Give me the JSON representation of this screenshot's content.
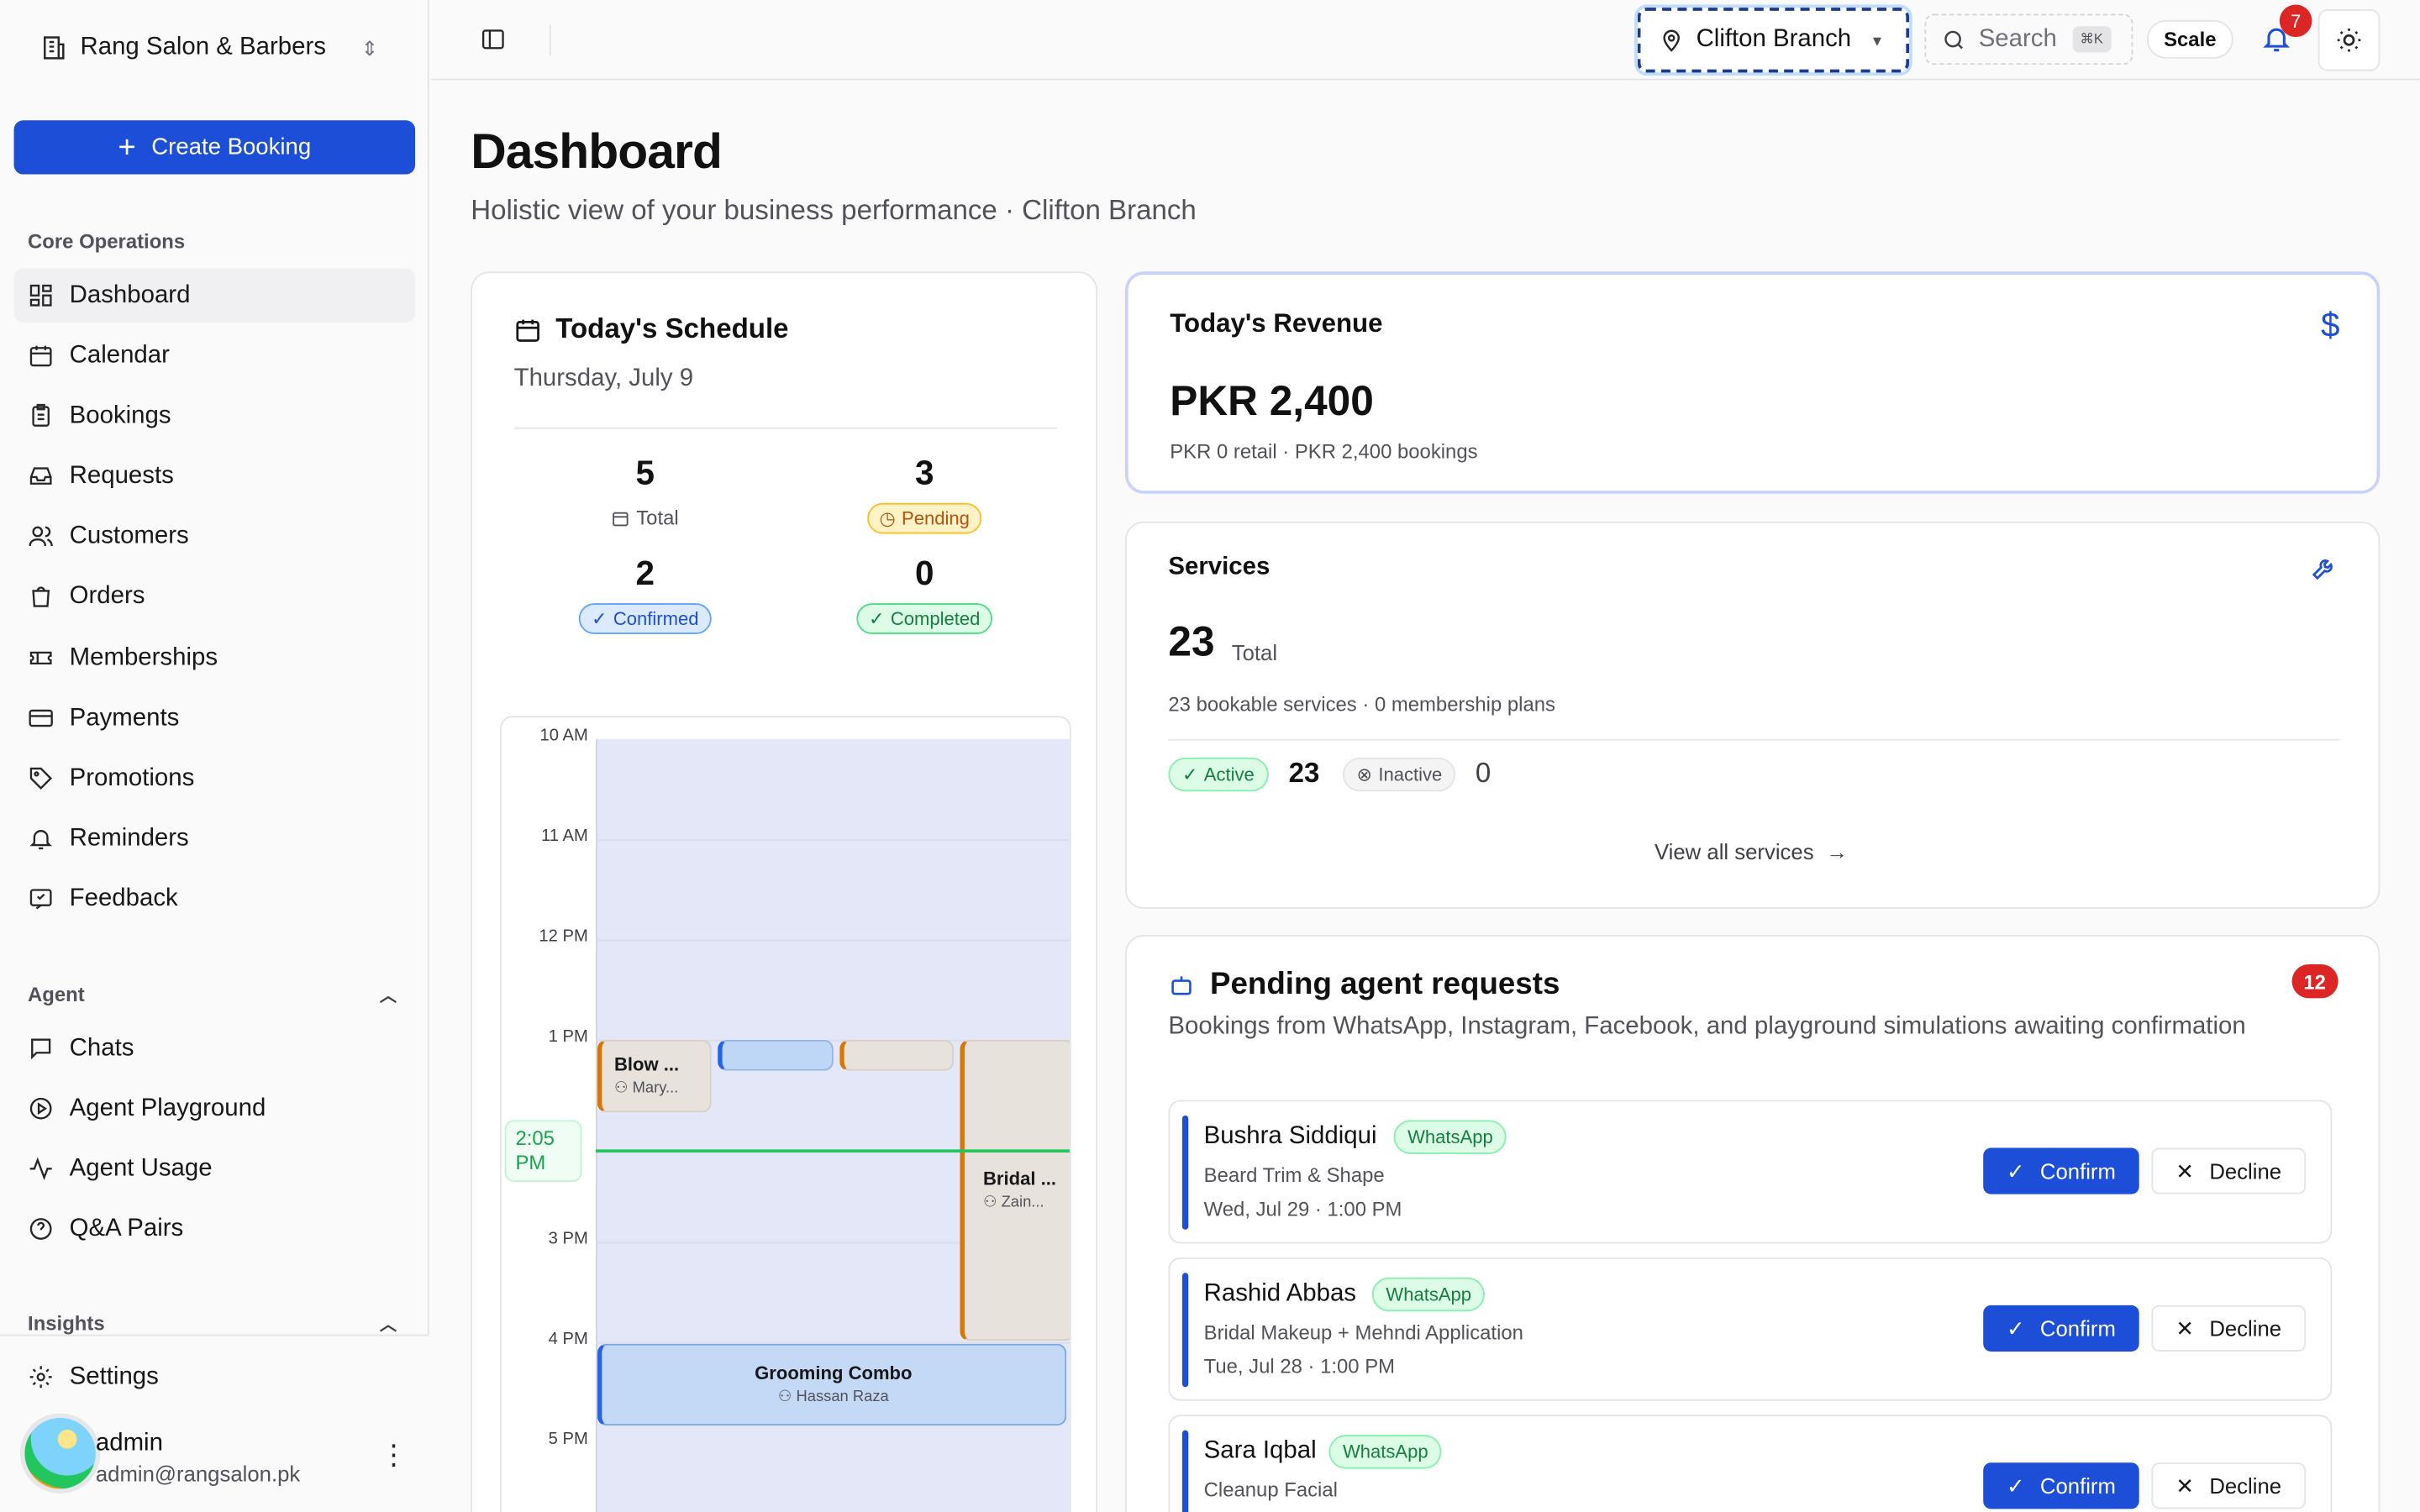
{
  "app": {
    "name": "Rang Salon & Barbers"
  },
  "sidebar": {
    "create_label": "Create Booking",
    "sections": {
      "core": "Core Operations",
      "agent": "Agent",
      "insights": "Insights"
    },
    "core_items": [
      {
        "label": "Dashboard",
        "icon": "dashboard-icon"
      },
      {
        "label": "Calendar",
        "icon": "calendar-icon"
      },
      {
        "label": "Bookings",
        "icon": "clipboard-icon"
      },
      {
        "label": "Requests",
        "icon": "inbox-icon"
      },
      {
        "label": "Customers",
        "icon": "users-icon"
      },
      {
        "label": "Orders",
        "icon": "shopping-bag-icon"
      },
      {
        "label": "Memberships",
        "icon": "ticket-icon"
      },
      {
        "label": "Payments",
        "icon": "credit-card-icon"
      },
      {
        "label": "Promotions",
        "icon": "tag-icon"
      },
      {
        "label": "Reminders",
        "icon": "bell-icon"
      },
      {
        "label": "Feedback",
        "icon": "feedback-icon"
      }
    ],
    "agent_items": [
      {
        "label": "Chats",
        "icon": "chat-icon"
      },
      {
        "label": "Agent Playground",
        "icon": "play-icon"
      },
      {
        "label": "Agent Usage",
        "icon": "activity-icon"
      },
      {
        "label": "Q&A Pairs",
        "icon": "help-icon"
      }
    ],
    "settings_label": "Settings",
    "user": {
      "name": "admin",
      "email": "admin@rangsalon.pk"
    }
  },
  "topbar": {
    "branch": "Clifton Branch",
    "search_placeholder": "Search",
    "search_kbd": "⌘K",
    "scale_label": "Scale",
    "notification_count": "7"
  },
  "page": {
    "title": "Dashboard",
    "subtitle": "Holistic view of your business performance · Clifton Branch"
  },
  "schedule": {
    "title": "Today's Schedule",
    "date": "Thursday, July 9",
    "stats": {
      "total": {
        "value": "5",
        "label": "Total"
      },
      "pending": {
        "value": "3",
        "label": "Pending"
      },
      "confirmed": {
        "value": "2",
        "label": "Confirmed"
      },
      "completed": {
        "value": "0",
        "label": "Completed"
      }
    },
    "hours": [
      "10 AM",
      "11 AM",
      "12 PM",
      "1 PM",
      "2 PM",
      "3 PM",
      "4 PM",
      "5 PM"
    ],
    "now_label": "2:05 PM",
    "events": [
      {
        "title": "Blow ...",
        "customer": "Mary..."
      },
      {
        "title": "Bridal ...",
        "customer": "Zain..."
      },
      {
        "title": "Grooming Combo",
        "customer": "Hassan Raza"
      }
    ]
  },
  "revenue": {
    "title": "Today's Revenue",
    "amount": "PKR 2,400",
    "breakdown": "PKR 0 retail · PKR 2,400 bookings"
  },
  "services": {
    "title": "Services",
    "total": "23",
    "total_label": "Total",
    "breakdown": "23 bookable services · 0 membership plans",
    "active_label": "Active",
    "active_count": "23",
    "inactive_label": "Inactive",
    "inactive_count": "0",
    "view_all": "View all services"
  },
  "pending": {
    "title": "Pending agent requests",
    "count": "12",
    "subtitle": "Bookings from WhatsApp, Instagram, Facebook, and playground simulations awaiting confirmation",
    "confirm_label": "Confirm",
    "decline_label": "Decline",
    "requests": [
      {
        "name": "Bushra Siddiqui",
        "source": "WhatsApp",
        "service": "Beard Trim & Shape",
        "when": "Wed, Jul 29 · 1:00 PM"
      },
      {
        "name": "Rashid Abbas",
        "source": "WhatsApp",
        "service": "Bridal Makeup + Mehndi Application",
        "when": "Tue, Jul 28 · 1:00 PM"
      },
      {
        "name": "Sara Iqbal",
        "source": "WhatsApp",
        "service": "Cleanup Facial",
        "when": ""
      }
    ]
  }
}
